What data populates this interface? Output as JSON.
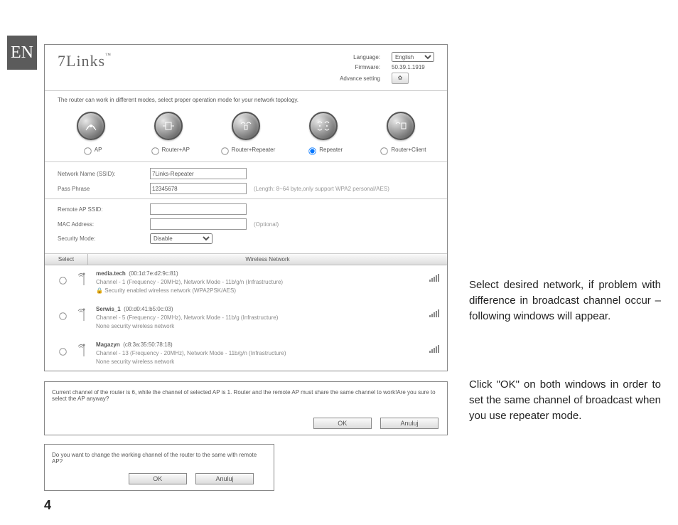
{
  "badge": "EN",
  "page_number": "4",
  "logo_text": "7Links",
  "header": {
    "language_label": "Language:",
    "language_value": "English",
    "firmware_label": "Firmware:",
    "firmware_value": "50.39.1.1919",
    "advance_label": "Advance setting"
  },
  "intro": "The router can work in different modes, select proper operation mode for your network topology.",
  "modes": {
    "ap": "AP",
    "router_ap": "Router+AP",
    "router_repeater": "Router+Repeater",
    "repeater": "Repeater",
    "router_client": "Router+Client",
    "selected": "repeater"
  },
  "form": {
    "ssid_label": "Network Name (SSID):",
    "ssid_value": "7Links-Repeater",
    "pass_label": "Pass Phrase",
    "pass_value": "12345678",
    "pass_hint": "(Length: 8~64 byte,only support WPA2 personal/AES)",
    "remote_ssid_label": "Remote AP SSID:",
    "remote_ssid_value": "",
    "mac_label": "MAC Address:",
    "mac_value": "",
    "mac_hint": "(Optional)",
    "security_label": "Security Mode:",
    "security_value": "Disable"
  },
  "net_header": {
    "select": "Select",
    "title": "Wireless Network"
  },
  "networks": [
    {
      "ssid": "media.tech",
      "mac": "(00:1d:7e:d2:9c:81)",
      "line2": "Channel - 1 (Frequency - 20MHz), Network Mode - 11b/g/n (Infrastructure)",
      "line3": "Security enabled wireless network (WPA2PSK/AES)",
      "lock": true
    },
    {
      "ssid": "Serwis_1",
      "mac": "(00:d0:41:b5:0c:03)",
      "line2": "Channel - 5 (Frequency - 20MHz), Network Mode - 11b/g (Infrastructure)",
      "line3": "None security wireless network",
      "lock": false
    },
    {
      "ssid": "Magazyn",
      "mac": "(c8:3a:35:50:78:18)",
      "line2": "Channel - 13 (Frequency - 20MHz), Network Mode - 11b/g/n (Infrastructure)",
      "line3": "None security wireless network",
      "lock": false
    }
  ],
  "dialog1": {
    "text": "Current channel of the router is 6, while the channel of selected AP is 1. Router and the remote AP must share the same channel to work!Are you sure to select the AP anyway?",
    "ok": "OK",
    "cancel": "Anuluj"
  },
  "dialog2": {
    "text": "Do you want to change the working channel of the router to the same with remote AP?",
    "ok": "OK",
    "cancel": "Anuluj"
  },
  "paragraph1": "Select desired network, if problem with difference in broadcast channel occur – following windows will appear.",
  "paragraph2": "Click \"OK\" on both windows in order to set the same channel of broadcast when you use repeater mode."
}
